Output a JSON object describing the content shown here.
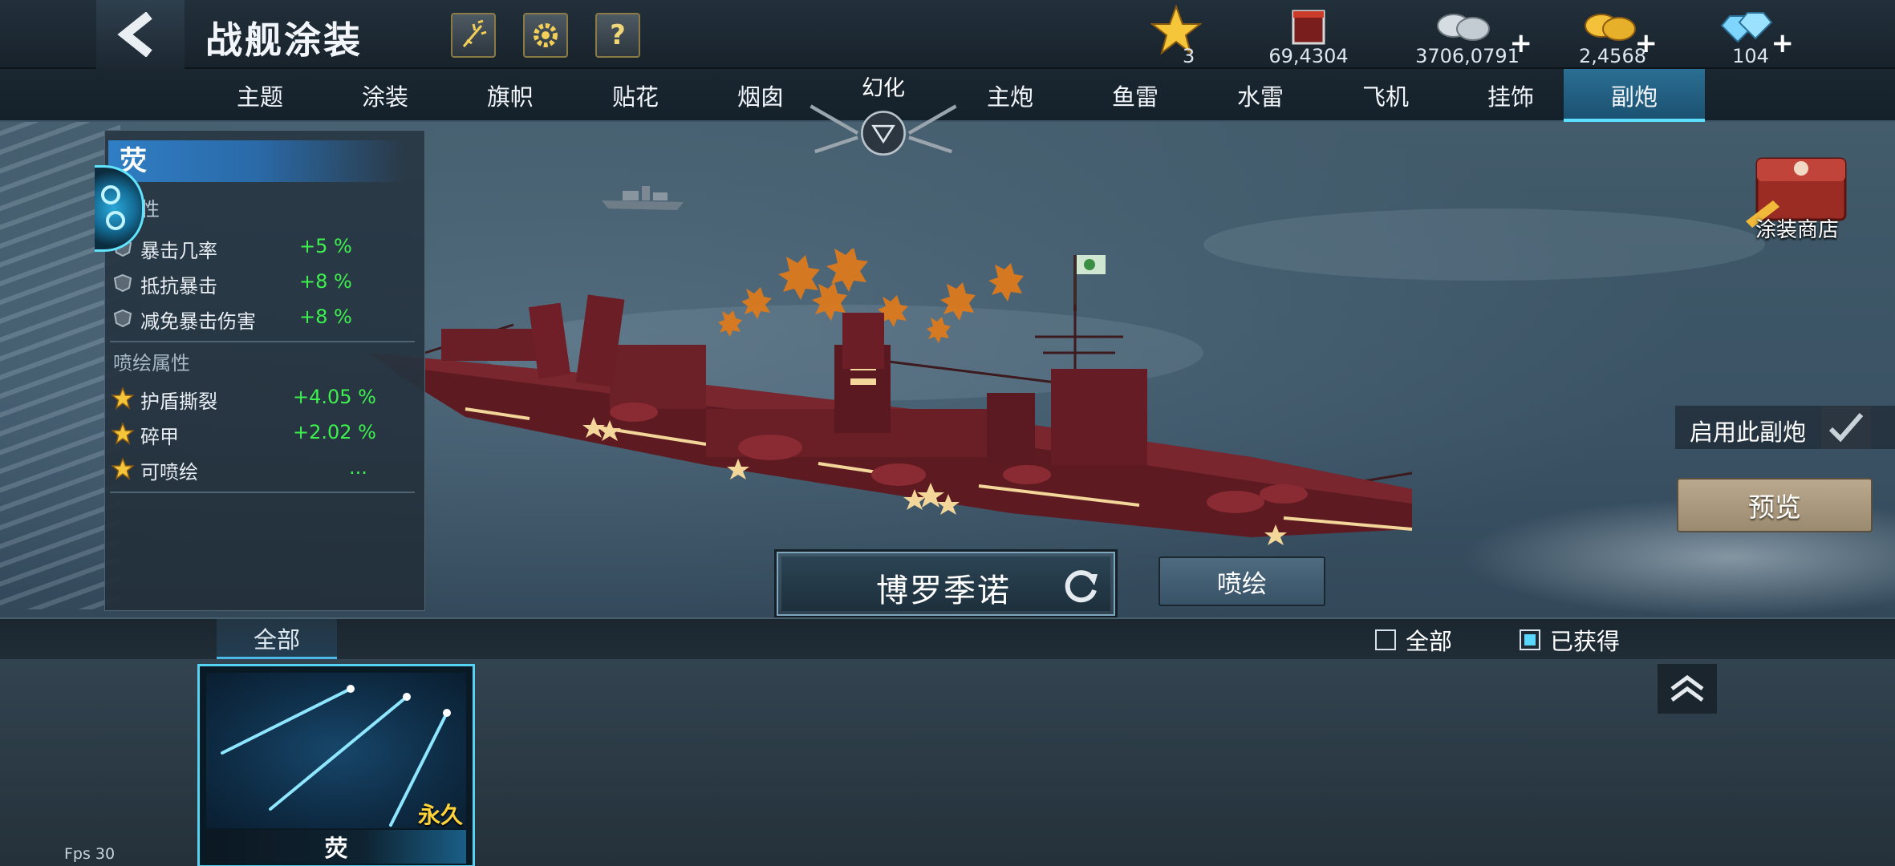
{
  "header": {
    "title": "战舰涂装",
    "buttons": [
      {
        "name": "fireworks-icon"
      },
      {
        "name": "gear-icon"
      },
      {
        "name": "help-icon",
        "glyph": "?"
      }
    ]
  },
  "resources": [
    {
      "icon": "star-icon",
      "value": "3",
      "plus": false
    },
    {
      "icon": "paint-bucket-icon",
      "value": "69,4304",
      "plus": false
    },
    {
      "icon": "silver-coins-icon",
      "value": "3706,0791",
      "plus": true
    },
    {
      "icon": "gold-coins-icon",
      "value": "2,4568",
      "plus": true
    },
    {
      "icon": "diamond-icon",
      "value": "104",
      "plus": true
    }
  ],
  "tabs": {
    "left": [
      "主题",
      "涂装",
      "旗帜",
      "贴花",
      "烟囱"
    ],
    "center": "幻化",
    "right": [
      "主炮",
      "鱼雷",
      "水雷",
      "飞机",
      "挂饰",
      "副炮"
    ],
    "active": "副炮"
  },
  "stats_panel": {
    "title": "荧",
    "subtitle_partial": "性",
    "stats": [
      {
        "name": "暴击几率",
        "value": "+5 %"
      },
      {
        "name": "抵抗暴击",
        "value": "+8 %"
      },
      {
        "name": "减免暴击伤害",
        "value": "+8 %"
      }
    ],
    "spray_section": "喷绘属性",
    "spray_stats": [
      {
        "name": "护盾撕裂",
        "value": "+4.05 %"
      },
      {
        "name": "碎甲",
        "value": "+2.02 %"
      },
      {
        "name": "可喷绘",
        "value": "..."
      }
    ]
  },
  "right_panel": {
    "shop_label": "涂装商店",
    "enable_label": "启用此副炮",
    "enabled": true,
    "preview_label": "预览"
  },
  "ship": {
    "name": "博罗季诺",
    "paint_label": "喷绘"
  },
  "drawer": {
    "tab_all": "全部",
    "filters": [
      {
        "label": "全部",
        "checked": false
      },
      {
        "label": "已获得",
        "checked": true
      }
    ],
    "items": [
      {
        "name": "荧",
        "badge": "永久"
      }
    ]
  },
  "fps": "Fps 30",
  "colors": {
    "accent_cyan": "#5de0ff",
    "stat_green": "#3ef04e",
    "badge_gold": "#ffd23a",
    "hull_red": "#6e1f26"
  }
}
